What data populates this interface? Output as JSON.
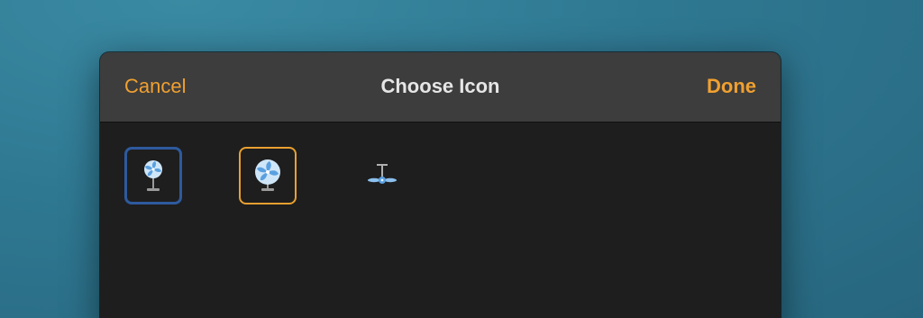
{
  "header": {
    "cancel_label": "Cancel",
    "title": "Choose Icon",
    "done_label": "Done"
  },
  "icons": [
    {
      "name": "pedestal-fan-icon",
      "state": "focused",
      "border_color": "#2e5a9e"
    },
    {
      "name": "desk-fan-icon",
      "state": "selected",
      "border_color": "#e8a030"
    },
    {
      "name": "ceiling-fan-icon",
      "state": "normal"
    }
  ],
  "colors": {
    "accent": "#f0a030",
    "header_bg": "#3d3d3d",
    "dialog_bg": "#1e1e1e",
    "fan_blue": "#5aa0e0"
  }
}
